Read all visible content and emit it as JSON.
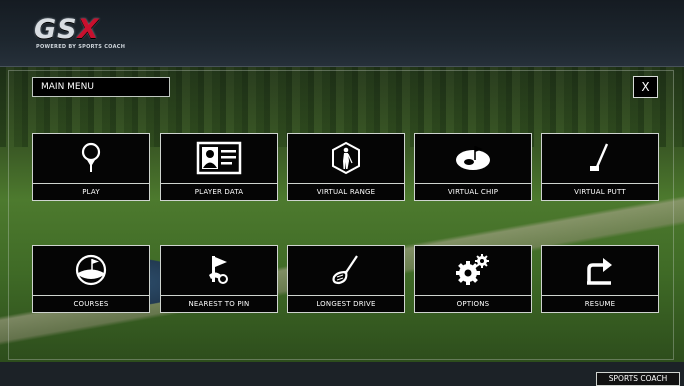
{
  "brand": {
    "logo_text": "GSX",
    "logo_tagline": "POWERED BY SPORTS COACH"
  },
  "menu": {
    "title": "MAIN MENU",
    "close_label": "X"
  },
  "tiles": [
    {
      "label": "PLAY",
      "icon": "golf-ball-on-tee-icon"
    },
    {
      "label": "PLAYER DATA",
      "icon": "id-card-icon"
    },
    {
      "label": "VIRTUAL RANGE",
      "icon": "golfer-hexagon-icon"
    },
    {
      "label": "VIRTUAL CHIP",
      "icon": "green-flag-icon"
    },
    {
      "label": "VIRTUAL PUTT",
      "icon": "putter-icon"
    },
    {
      "label": "COURSES",
      "icon": "course-globe-icon"
    },
    {
      "label": "NEAREST TO PIN",
      "icon": "pin-flag-icon"
    },
    {
      "label": "LONGEST DRIVE",
      "icon": "driver-club-icon"
    },
    {
      "label": "OPTIONS",
      "icon": "gears-icon"
    },
    {
      "label": "RESUME",
      "icon": "resume-arrow-icon"
    }
  ],
  "footer": {
    "badge": "SPORTS COACH"
  },
  "colors": {
    "tile_bg": "#050505",
    "tile_border": "#cfd4cf",
    "accent_red": "#c8102e"
  }
}
